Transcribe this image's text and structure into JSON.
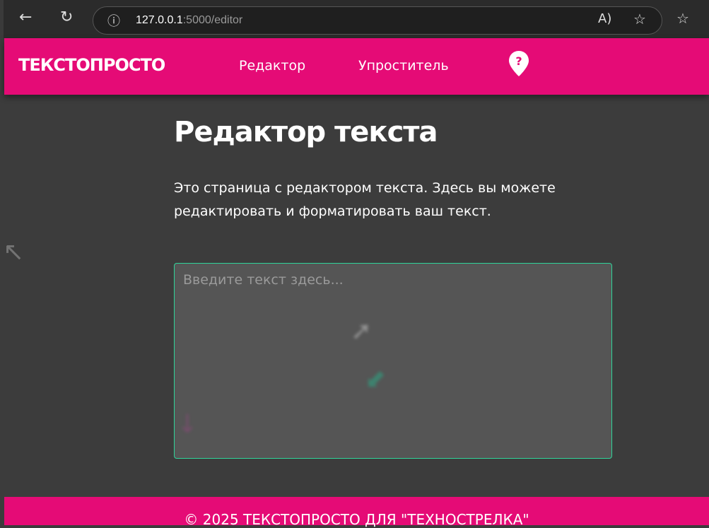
{
  "browser": {
    "url_host": "127.0.0.1",
    "url_rest": ":5000/editor"
  },
  "header": {
    "logo": "ТЕКСТОПРОСТО",
    "nav": [
      "Редактор",
      "Упроститель"
    ]
  },
  "main": {
    "title": "Редактор текста",
    "description": "Это страница с редактором текста. Здесь вы можете редактировать и форматировать ваш текст.",
    "placeholder": "Введите текст здесь..."
  },
  "footer": {
    "text": "© 2025 ТЕКСТОПРОСТО ДЛЯ \"ТЕХНОСТРЕЛКА\""
  },
  "colors": {
    "brand": "#e50b76",
    "accent": "#2fd49a"
  }
}
